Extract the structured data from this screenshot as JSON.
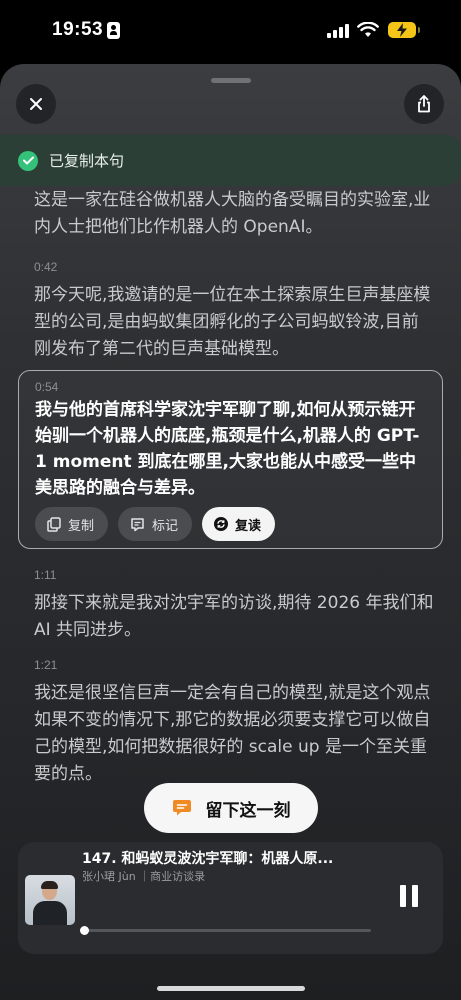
{
  "status_bar": {
    "time": "19:53",
    "battery_color": "#f5c518"
  },
  "toolbar": {
    "close_icon": "close-icon",
    "share_icon": "share-icon"
  },
  "toast": {
    "text": "已复制本句",
    "icon": "check-circle-icon",
    "color": "#34c27a"
  },
  "transcript": {
    "segments": [
      {
        "timestamp": "",
        "text": "这是一家在硅谷做机器人大脑的备受瞩目的实验室,业内人士把他们比作机器人的 OpenAI。"
      },
      {
        "timestamp": "0:42",
        "text": "那今天呢,我邀请的是一位在本土探索原生巨声基座模型的公司,是由蚂蚁集团孵化的子公司蚂蚁铃波,目前刚发布了第二代的巨声基础模型。"
      },
      {
        "timestamp": "0:54",
        "text": "我与他的首席科学家沈宇军聊了聊,如何从预示链开始驯一个机器人的底座,瓶颈是什么,机器人的 GPT-1 moment 到底在哪里,大家也能从中感受一些中美思路的融合与差异。"
      },
      {
        "timestamp": "1:11",
        "text": "那接下来就是我对沈宇军的访谈,期待 2026 年我们和 AI 共同进步。"
      },
      {
        "timestamp": "1:21",
        "text": "我还是很坚信巨声一定会有自己的模型,就是这个观点如果不变的情况下,那它的数据必须要支撑它可以做自己的模型,如何把数据很好的 scale up 是一个至关重要的点。"
      }
    ],
    "active_actions": {
      "copy": "复制",
      "mark": "标记",
      "repeat": "复读"
    }
  },
  "keep_moment": {
    "label": "留下这一刻",
    "accent": "#f08a24"
  },
  "player": {
    "title": "147. 和蚂蚁灵波沈宇军聊：机器人原...",
    "subtitle": "张小珺 Jùn ｜商业访谈录",
    "progress": 0.02
  }
}
